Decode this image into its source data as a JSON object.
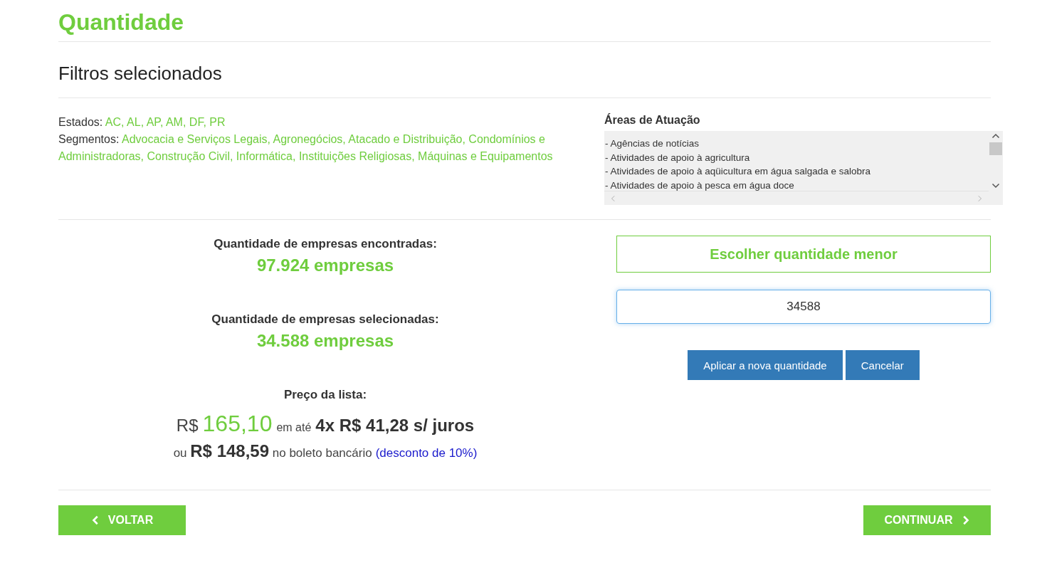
{
  "title": "Quantidade",
  "filters_heading": "Filtros selecionados",
  "filters": [
    {
      "label": "Estados:",
      "value": "AC, AL, AP, AM, DF, PR"
    },
    {
      "label": "Segmentos:",
      "value": "Advocacia e Serviços Legais, Agronegócios, Atacado e Distribuição, Condomínios e Administradoras, Construção Civil, Informática, Instituições Religiosas, Máquinas e Equipamentos"
    }
  ],
  "areas": {
    "title": "Áreas de Atuação",
    "items": [
      "- Agências de notícias",
      "- Atividades de apoio à agricultura",
      "- Atividades de apoio à aqüicultura em água salgada e salobra",
      "- Atividades de apoio à pesca em água doce"
    ]
  },
  "found": {
    "label": "Quantidade de empresas encontradas:",
    "value": "97.924 empresas"
  },
  "selected": {
    "label": "Quantidade de empresas selecionadas:",
    "value": "34.588 empresas"
  },
  "price": {
    "label": "Preço da lista:",
    "currency": "R$",
    "amount": "165,10",
    "installment_prefix": "em até",
    "installment": "4x R$ 41,28 s/ juros",
    "boleto": "ou **R$ 148,59** no boleto bancário",
    "discount_link": "(desconto de 10%)"
  },
  "choose_button": "Escolher quantidade menor",
  "quantity_field": {
    "value": "34588"
  },
  "apply_button": "Aplicar a nova quantidade",
  "cancel_button": "Cancelar",
  "back_button": "VOLTAR",
  "continue_button": "CONTINUAR"
}
